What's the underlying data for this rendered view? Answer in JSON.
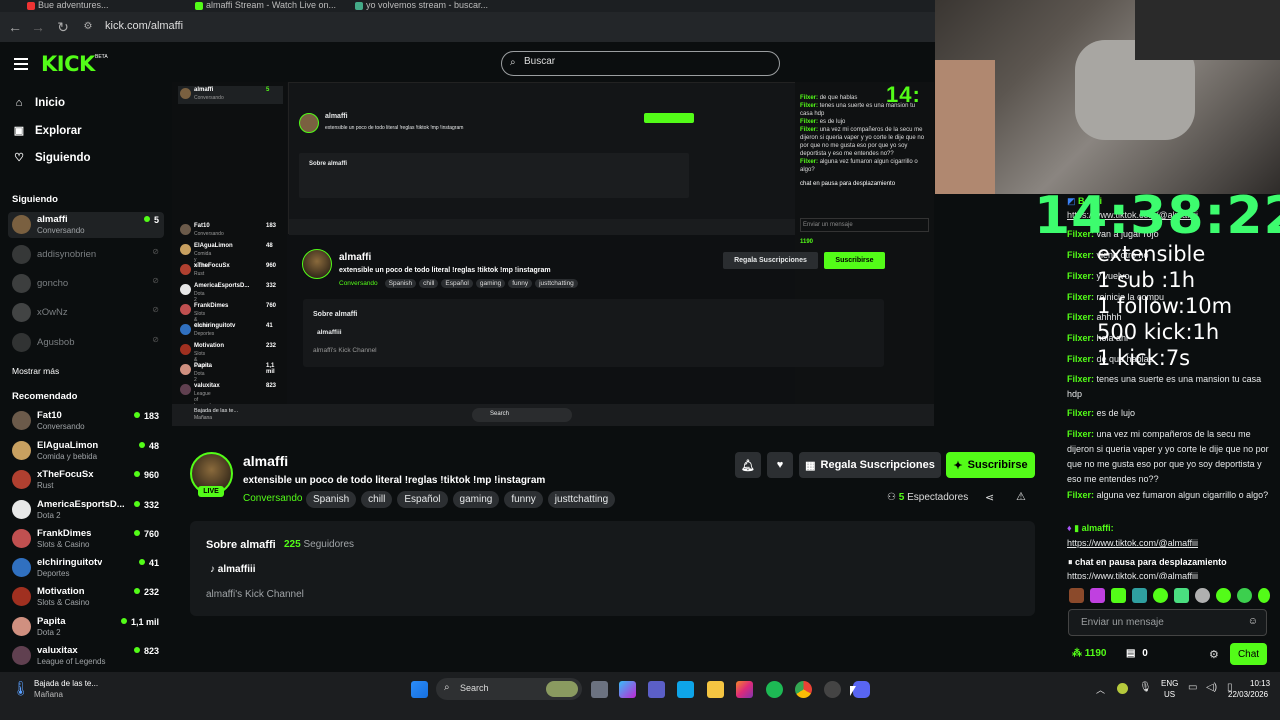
{
  "browser": {
    "tabs": [
      "Bue adventures...",
      "almaffi Stream - Watch Live on...",
      "yo volvemos stream - buscar..."
    ],
    "url": "kick.com/almaffi"
  },
  "brand": {
    "logo": "KICK",
    "beta": "BETA",
    "accent": "#53fc18"
  },
  "search": {
    "placeholder": "Buscar"
  },
  "nav": [
    {
      "label": "Inicio",
      "icon": "home-icon"
    },
    {
      "label": "Explorar",
      "icon": "compass-icon"
    },
    {
      "label": "Siguiendo",
      "icon": "heart-icon"
    }
  ],
  "sidebar": {
    "following_title": "Siguiendo",
    "following": [
      {
        "name": "almaffi",
        "category": "Conversando",
        "viewers": "5",
        "live": true
      },
      {
        "name": "addisynobrien",
        "live": false
      },
      {
        "name": "goncho",
        "live": false
      },
      {
        "name": "xOwNz",
        "live": false
      },
      {
        "name": "Agusbob",
        "live": false
      }
    ],
    "show_more": "Mostrar más",
    "recommended_title": "Recomendado",
    "recommended": [
      {
        "name": "Fat10",
        "category": "Conversando",
        "viewers": "183"
      },
      {
        "name": "ElAguaLimon",
        "category": "Comida y bebida",
        "viewers": "48"
      },
      {
        "name": "xTheFocuSx",
        "category": "Rust",
        "viewers": "960"
      },
      {
        "name": "AmericaEsportsD...",
        "category": "Dota 2",
        "viewers": "332"
      },
      {
        "name": "FrankDimes",
        "category": "Slots & Casino",
        "viewers": "760"
      },
      {
        "name": "elchiringuitotv",
        "category": "Deportes",
        "viewers": "41"
      },
      {
        "name": "Motivation",
        "category": "Slots & Casino",
        "viewers": "232"
      },
      {
        "name": "Papita",
        "category": "Dota 2",
        "viewers": "1,1 mil"
      },
      {
        "name": "valuxitax",
        "category": "League of Legends",
        "viewers": "823"
      }
    ]
  },
  "stream": {
    "name": "almaffi",
    "live": "LIVE",
    "title": "extensible un poco de todo literal !reglas !tiktok !mp !instagram",
    "category": "Conversando",
    "tags": [
      "Spanish",
      "chill",
      "Español",
      "gaming",
      "funny",
      "justtchatting"
    ],
    "gift_label": "Regala Suscripciones",
    "subscribe_label": "Suscribirse",
    "viewers": "5",
    "viewers_label": "Espectadores",
    "about_title": "Sobre almaffi",
    "followers": "225",
    "followers_label": "Seguidores",
    "social": "almaffiii",
    "description": "almaffi's Kick Channel"
  },
  "overlay": {
    "timer": "14:38:22",
    "mini_timer": "14:",
    "goals": [
      "extensible",
      "1 sub :1h",
      "1 follow:10m",
      "500 kick:1h",
      "1 kick:7s"
    ]
  },
  "chat": {
    "messages": [
      {
        "user": "BotDi",
        "text": ""
      },
      {
        "user": "",
        "text": "https://www.tiktok.com/@almaffiii"
      },
      {
        "user": "Filxer:",
        "text": "van a jugar rojo"
      },
      {
        "user": "Filxer:",
        "text": "viene otro no"
      },
      {
        "user": "Filxer:",
        "text": "y vuelvo"
      },
      {
        "user": "Filxer:",
        "text": "reinicie la compu"
      },
      {
        "user": "Filxer:",
        "text": "ahhhh"
      },
      {
        "user": "Filxer:",
        "text": "hola ahi"
      },
      {
        "user": "Filxer:",
        "text": "de que hablas"
      },
      {
        "user": "Filxer:",
        "text": "tenes una suerte es una mansion tu casa hdp"
      },
      {
        "user": "Filxer:",
        "text": "es de lujo"
      },
      {
        "user": "Filxer:",
        "text": "una vez mi compañeros de la secu me dijeron si queria vaper y yo corte le dije que no por que no me gusta eso por que yo soy deportista y eso me entendes no??"
      },
      {
        "user": "Filxer:",
        "text": "alguna vez fumaron algun cigarrillo o algo?"
      },
      {
        "user": "almaffi:",
        "text": "https://www.tiktok.com/@almaffiii"
      }
    ],
    "paused": "chat en pausa para desplazamiento",
    "input_placeholder": "Enviar un mensaje",
    "points": "1190",
    "gifts": "0",
    "send_label": "Chat"
  },
  "taskbar": {
    "news_title": "Bajada de las te...",
    "news_sub": "Mañana",
    "search": "Search",
    "lang": "ENG",
    "region": "US",
    "time": "10:13",
    "date": "22/03/2026"
  }
}
